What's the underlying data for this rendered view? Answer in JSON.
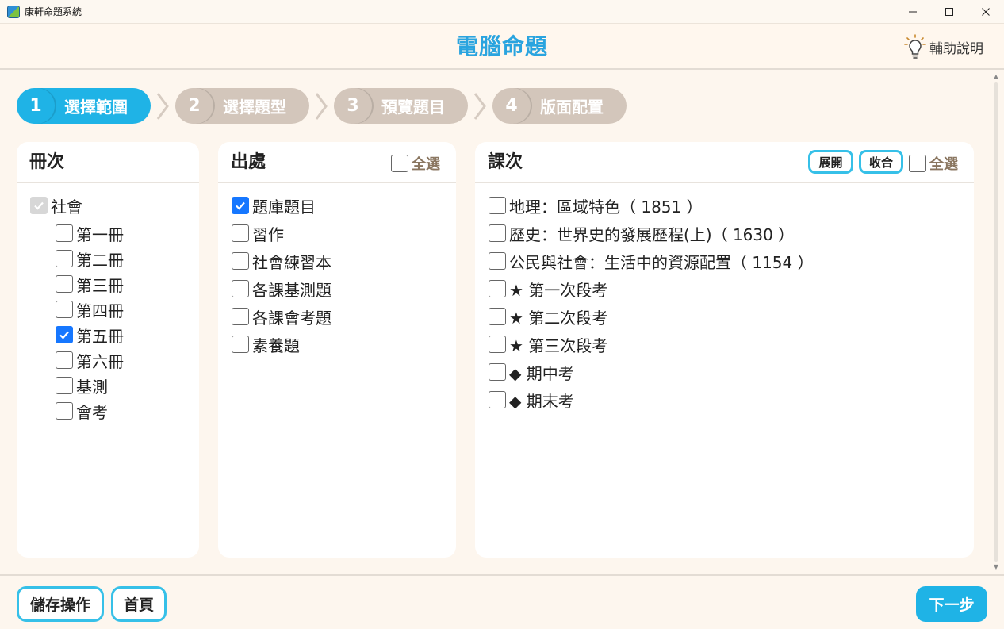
{
  "window": {
    "app_title": "康軒命題系統"
  },
  "header": {
    "title": "電腦命題",
    "help_label": "輔助說明"
  },
  "steps": [
    {
      "num": "1",
      "label": "選擇範圍",
      "active": true
    },
    {
      "num": "2",
      "label": "選擇題型",
      "active": false
    },
    {
      "num": "3",
      "label": "預覽題目",
      "active": false
    },
    {
      "num": "4",
      "label": "版面配置",
      "active": false
    }
  ],
  "panels": {
    "volumes": {
      "title": "冊次",
      "root": {
        "label": "社會",
        "state": "disabled-checked"
      },
      "items": [
        {
          "label": "第一冊",
          "checked": false
        },
        {
          "label": "第二冊",
          "checked": false
        },
        {
          "label": "第三冊",
          "checked": false
        },
        {
          "label": "第四冊",
          "checked": false
        },
        {
          "label": "第五冊",
          "checked": true
        },
        {
          "label": "第六冊",
          "checked": false
        },
        {
          "label": "基測",
          "checked": false
        },
        {
          "label": "會考",
          "checked": false
        }
      ]
    },
    "sources": {
      "title": "出處",
      "select_all_label": "全選",
      "items": [
        {
          "label": "題庫題目",
          "checked": true
        },
        {
          "label": "習作",
          "checked": false
        },
        {
          "label": "社會練習本",
          "checked": false
        },
        {
          "label": "各課基測題",
          "checked": false
        },
        {
          "label": "各課會考題",
          "checked": false
        },
        {
          "label": "素養題",
          "checked": false
        }
      ]
    },
    "lessons": {
      "title": "課次",
      "expand_label": "展開",
      "collapse_label": "收合",
      "select_all_label": "全選",
      "items": [
        {
          "label": "地理：區域特色（ 1851 ）",
          "checked": false
        },
        {
          "label": "歷史：世界史的發展歷程(上)（ 1630 ）",
          "checked": false
        },
        {
          "label": "公民與社會：生活中的資源配置（ 1154 ）",
          "checked": false
        },
        {
          "label": "★ 第一次段考",
          "checked": false
        },
        {
          "label": "★ 第二次段考",
          "checked": false
        },
        {
          "label": "★ 第三次段考",
          "checked": false
        },
        {
          "label": "◆ 期中考",
          "checked": false
        },
        {
          "label": "◆ 期末考",
          "checked": false
        }
      ]
    }
  },
  "footer": {
    "save_label": "儲存操作",
    "home_label": "首頁",
    "next_label": "下一步"
  },
  "colors": {
    "accent": "#1fb3e6",
    "title": "#2aa4df",
    "step_inactive": "#d3c6bb",
    "background": "#fdf6ee",
    "checkbox_checked": "#1677ff"
  }
}
